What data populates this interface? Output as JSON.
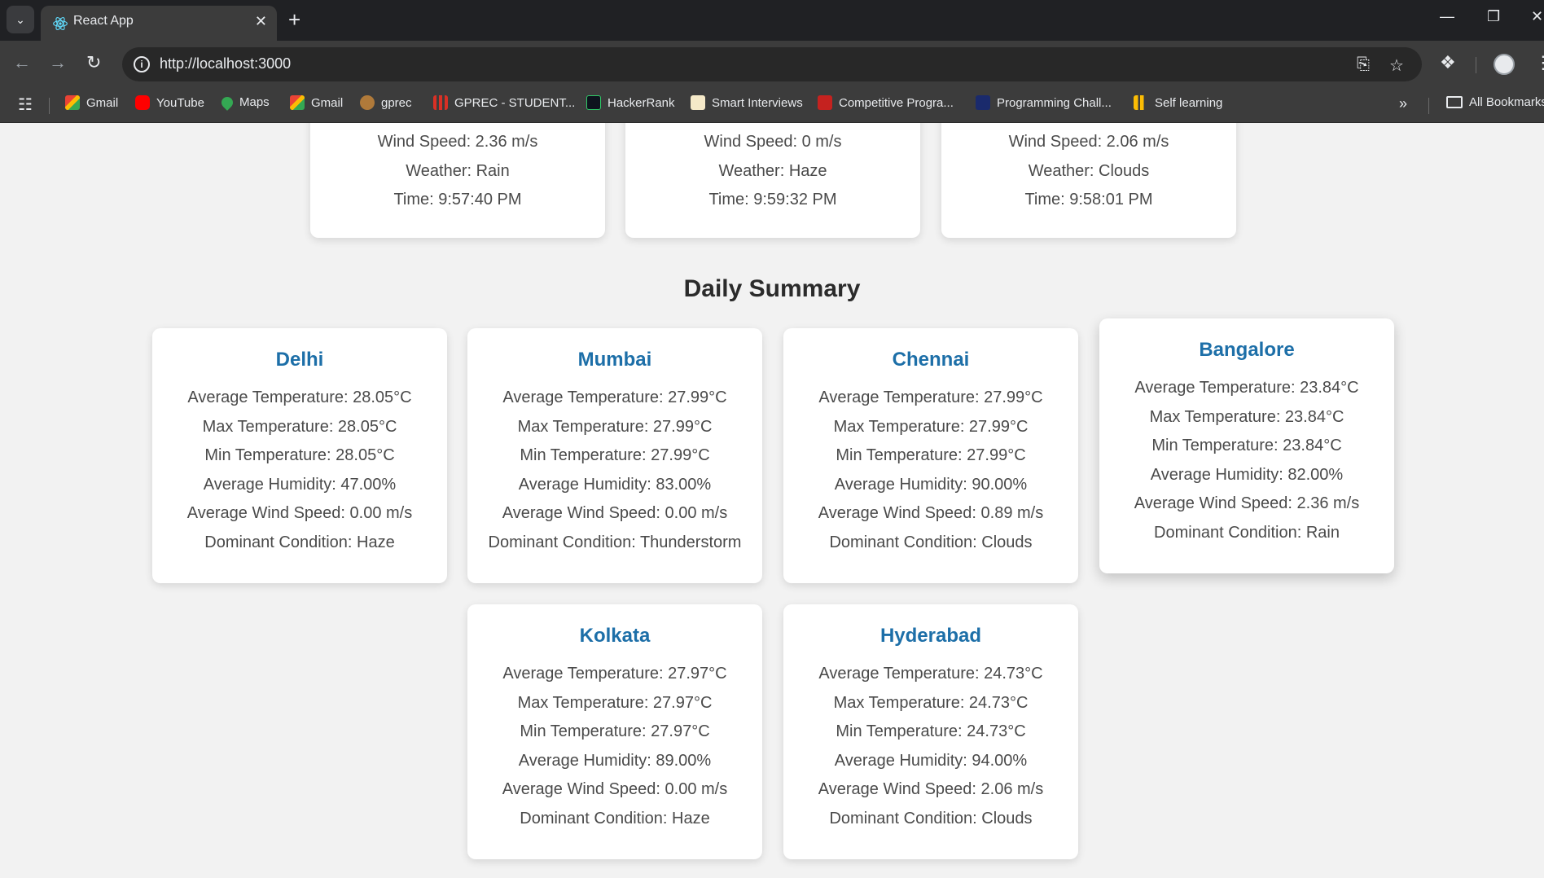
{
  "browser": {
    "tab_title": "React App",
    "url": "http://localhost:3000",
    "bookmarks": [
      {
        "label": "Gmail",
        "icon": "gmail-icon"
      },
      {
        "label": "YouTube",
        "icon": "youtube-icon"
      },
      {
        "label": "Maps",
        "icon": "maps-icon"
      },
      {
        "label": "Gmail",
        "icon": "gmail-icon"
      },
      {
        "label": "gprec",
        "icon": "gprec-icon"
      },
      {
        "label": "GPREC - STUDENT...",
        "icon": "gprec-student-icon"
      },
      {
        "label": "HackerRank",
        "icon": "hackerrank-icon"
      },
      {
        "label": "Smart Interviews",
        "icon": "smart-interviews-icon"
      },
      {
        "label": "Competitive Progra...",
        "icon": "competitive-programming-icon"
      },
      {
        "label": "Programming Chall...",
        "icon": "programming-challenges-icon"
      },
      {
        "label": "Self learning",
        "icon": "self-learning-icon"
      }
    ],
    "all_bookmarks": "All Bookmarks"
  },
  "current_cards": [
    {
      "wind": "Wind Speed: 2.36 m/s",
      "weather": "Weather: Rain",
      "time": "Time: 9:57:40 PM"
    },
    {
      "wind": "Wind Speed: 0 m/s",
      "weather": "Weather: Haze",
      "time": "Time: 9:59:32 PM"
    },
    {
      "wind": "Wind Speed: 2.06 m/s",
      "weather": "Weather: Clouds",
      "time": "Time: 9:58:01 PM"
    }
  ],
  "summary": {
    "title": "Daily Summary",
    "cities": [
      {
        "name": "Delhi",
        "avg_temp": "Average Temperature: 28.05°C",
        "max_temp": "Max Temperature: 28.05°C",
        "min_temp": "Min Temperature: 28.05°C",
        "humidity": "Average Humidity: 47.00%",
        "wind": "Average Wind Speed: 0.00 m/s",
        "condition": "Dominant Condition: Haze"
      },
      {
        "name": "Mumbai",
        "avg_temp": "Average Temperature: 27.99°C",
        "max_temp": "Max Temperature: 27.99°C",
        "min_temp": "Min Temperature: 27.99°C",
        "humidity": "Average Humidity: 83.00%",
        "wind": "Average Wind Speed: 0.00 m/s",
        "condition": "Dominant Condition: Thunderstorm"
      },
      {
        "name": "Chennai",
        "avg_temp": "Average Temperature: 27.99°C",
        "max_temp": "Max Temperature: 27.99°C",
        "min_temp": "Min Temperature: 27.99°C",
        "humidity": "Average Humidity: 90.00%",
        "wind": "Average Wind Speed: 0.89 m/s",
        "condition": "Dominant Condition: Clouds"
      },
      {
        "name": "Bangalore",
        "avg_temp": "Average Temperature: 23.84°C",
        "max_temp": "Max Temperature: 23.84°C",
        "min_temp": "Min Temperature: 23.84°C",
        "humidity": "Average Humidity: 82.00%",
        "wind": "Average Wind Speed: 2.36 m/s",
        "condition": "Dominant Condition: Rain"
      },
      {
        "name": "Kolkata",
        "avg_temp": "Average Temperature: 27.97°C",
        "max_temp": "Max Temperature: 27.97°C",
        "min_temp": "Min Temperature: 27.97°C",
        "humidity": "Average Humidity: 89.00%",
        "wind": "Average Wind Speed: 0.00 m/s",
        "condition": "Dominant Condition: Haze"
      },
      {
        "name": "Hyderabad",
        "avg_temp": "Average Temperature: 24.73°C",
        "max_temp": "Max Temperature: 24.73°C",
        "min_temp": "Min Temperature: 24.73°C",
        "humidity": "Average Humidity: 94.00%",
        "wind": "Average Wind Speed: 2.06 m/s",
        "condition": "Dominant Condition: Clouds"
      }
    ]
  },
  "colors": {
    "accent": "#1d6fa8",
    "page_bg": "#f2f2f2",
    "card_bg": "#ffffff"
  }
}
